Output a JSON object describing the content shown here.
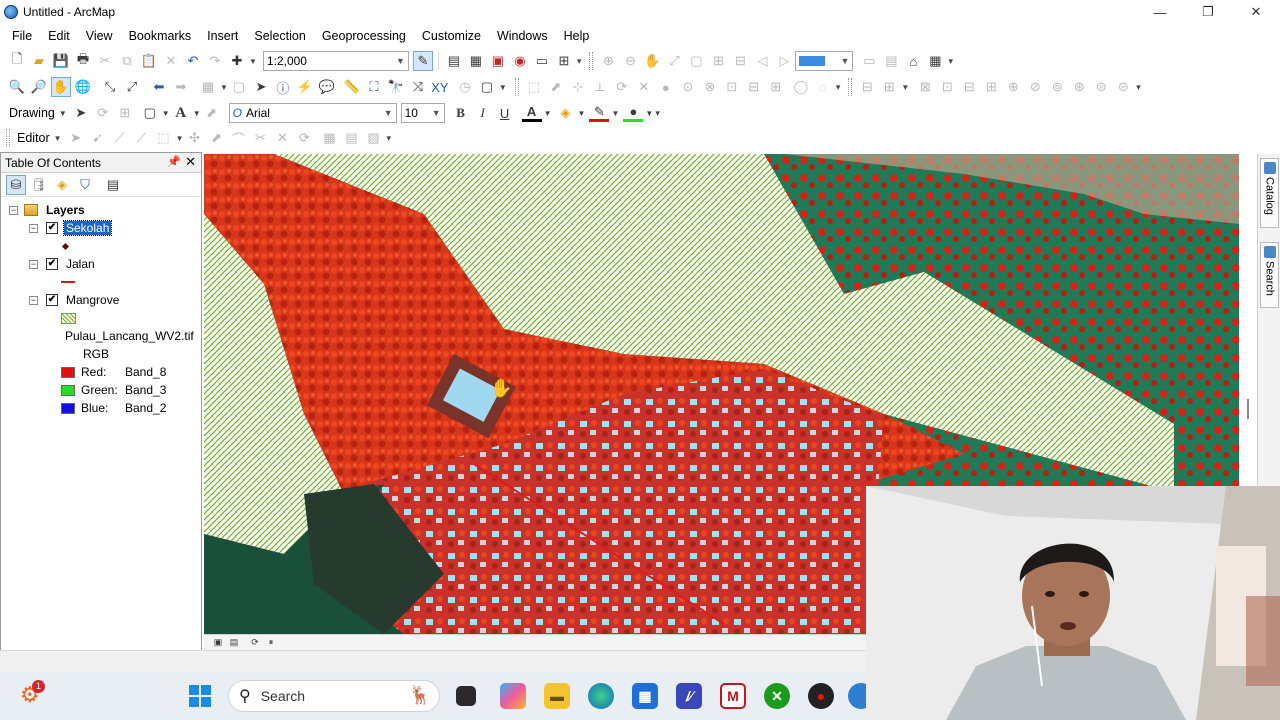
{
  "window": {
    "title": "Untitled - ArcMap",
    "minimize": "—",
    "maximize": "❐",
    "close": "✕"
  },
  "menu": [
    "File",
    "Edit",
    "View",
    "Bookmarks",
    "Insert",
    "Selection",
    "Geoprocessing",
    "Customize",
    "Windows",
    "Help"
  ],
  "toolbar": {
    "scale_value": "1:2,000",
    "drawing_label": "Drawing",
    "font_name": "Arial",
    "font_size": "10",
    "bold": "B",
    "italic": "I",
    "underline": "U",
    "font_color_glyph": "A",
    "editor_label": "Editor"
  },
  "toc": {
    "title": "Table Of Contents",
    "pin": "📌",
    "close": "✕",
    "root": "Layers",
    "layers": [
      {
        "name": "Sekolah",
        "checked": "✔",
        "selected": true,
        "expander": "−"
      },
      {
        "name": "Jalan",
        "checked": "✔",
        "selected": false,
        "expander": "−"
      },
      {
        "name": "Mangrove",
        "checked": "✔",
        "selected": false,
        "expander": "−"
      }
    ],
    "raster_name": "Pulau_Lancang_WV2.tif",
    "raster_type": "RGB",
    "bands": [
      {
        "channel": "Red:",
        "band": "Band_8",
        "color": "#e01010"
      },
      {
        "channel": "Green:",
        "band": "Band_3",
        "color": "#22e022"
      },
      {
        "channel": "Blue:",
        "band": "Band_2",
        "color": "#1010e0"
      }
    ]
  },
  "side_tabs": [
    "Catalog",
    "Search"
  ],
  "taskbar": {
    "search_placeholder": "Search",
    "weather_badge": "1"
  },
  "colors": {
    "selection": "#1e64c8",
    "mangrove_hatch": "#6fb21e",
    "vegetation_red": "#e0371c",
    "water_green": "#1e7a56"
  }
}
